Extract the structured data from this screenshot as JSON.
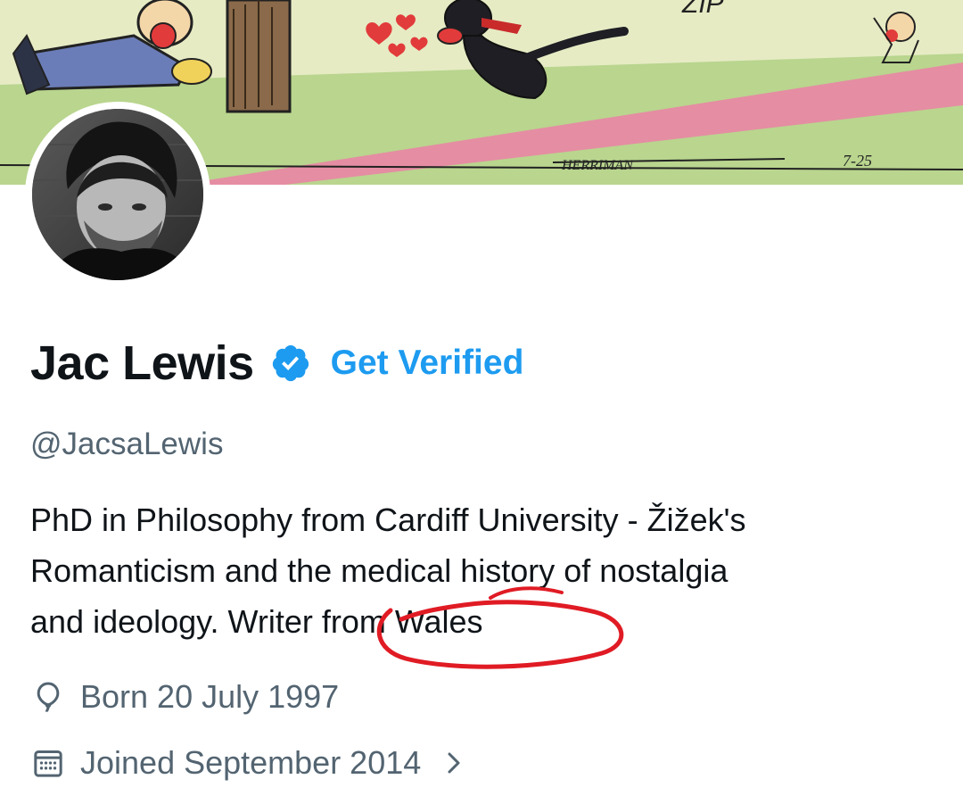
{
  "banner": {
    "comic_texts": [
      "ZIP",
      "HERRIMAN",
      "7-25"
    ]
  },
  "profile": {
    "name": "Jac Lewis",
    "get_verified_label": "Get Verified",
    "handle": "@JacsaLewis",
    "bio_lines": [
      "PhD in Philosophy from Cardiff University - Žižek's",
      "Romanticism and the medical history of nostalgia",
      "and ideology.  Writer from Wales"
    ],
    "birth_date": "Born 20 July 1997",
    "joined_date": "Joined September 2014"
  },
  "icons": {
    "verified": "verified-badge-icon",
    "birth": "balloon-icon",
    "joined": "calendar-icon",
    "joined_chevron": "chevron-right-icon"
  },
  "colors": {
    "accent": "#1d9bf0",
    "text_primary": "#0f1419",
    "text_secondary": "#536471",
    "annotation": "#e01b24"
  }
}
